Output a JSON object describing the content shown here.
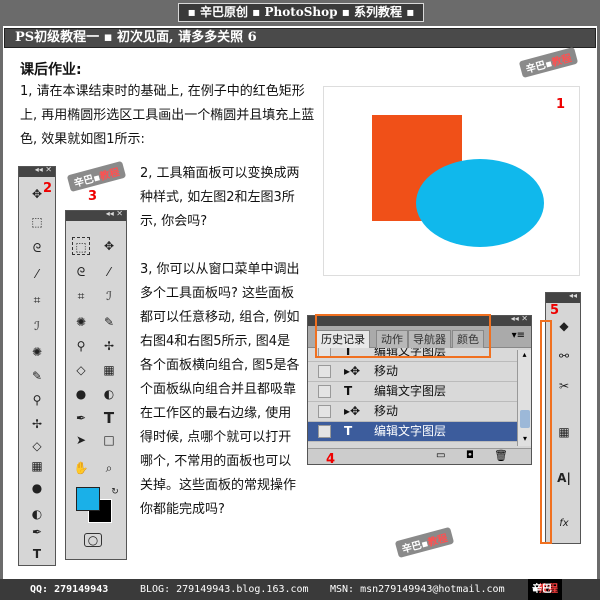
{
  "banner": "▪ 辛巴原创 ▪ PhotoShop ▪ 系列教程 ▪",
  "title": "PS初级教程一 ▪ 初次见面, 请多多关照 6",
  "homework_heading": "课后作业:",
  "paragraph1": "1, 请在本课结束时的基础上, 在例子中的红色矩形上, 再用椭圆形选区工具画出一个椭圆并且填充上蓝色, 效果就如图1所示:",
  "paragraph2": "2, 工具箱面板可以变换成两种样式, 如左图2和左图3所示, 你会吗?",
  "paragraph3": "3, 你可以从窗口菜单中调出多个工具面板吗? 这些面板都可以任意移动, 组合, 例如右图4和右图5所示, 图4是各个面板横向组合, 图5是各个面板纵向组合并且都吸靠在工作区的最右边缘, 使用得时候, 点哪个就可以打开哪个, 不常用的面板也可以关掉。这些面板的常规操作你都能完成吗?",
  "labels": {
    "fig1": "1",
    "fig2": "2",
    "fig3": "3",
    "fig4": "4",
    "fig5": "5"
  },
  "colors": {
    "rect": "#f05018",
    "ellipse": "#10b8ec",
    "fg_swatch": "#1ab0e8",
    "bg_swatch": "#000000",
    "accent": "#f07020"
  },
  "history_panel": {
    "tabs": [
      "历史记录",
      "动作",
      "导航器",
      "颜色"
    ],
    "rows": [
      {
        "icon": "T",
        "label": "编辑文字图层",
        "selected": false
      },
      {
        "icon": "▸✥",
        "label": "移动",
        "selected": false
      },
      {
        "icon": "T",
        "label": "编辑文字图层",
        "selected": false
      },
      {
        "icon": "▸✥",
        "label": "移动",
        "selected": false
      },
      {
        "icon": "T",
        "label": "编辑文字图层",
        "selected": true
      }
    ]
  },
  "stamp": {
    "a": "辛巴",
    "b": "教程"
  },
  "footer": {
    "qq": "QQ: 279149943",
    "blog": "BLOG: 279149943.blog.163.com",
    "msn": "MSN: msn279149943@hotmail.com",
    "brand_a": "辛巴",
    "brand_b": "教程"
  }
}
